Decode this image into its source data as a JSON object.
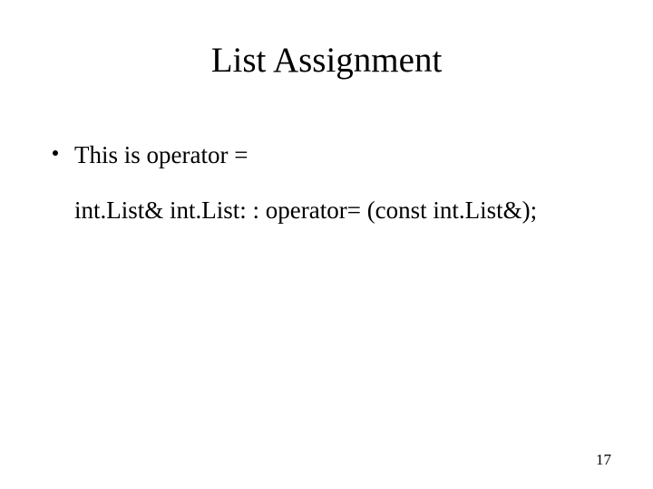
{
  "title": "List Assignment",
  "bullet1": "This is operator =",
  "codeLine": "int.List& int.List: : operator= (const int.List&);",
  "pageNumber": "17"
}
